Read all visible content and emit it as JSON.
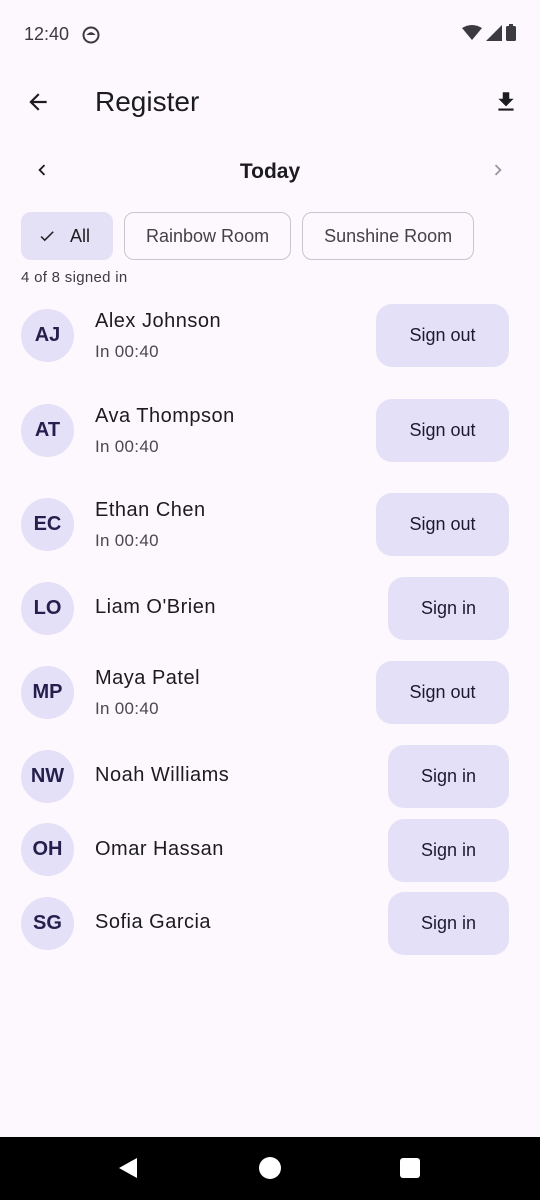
{
  "status_bar": {
    "time": "12:40"
  },
  "header": {
    "title": "Register"
  },
  "date_nav": {
    "label": "Today"
  },
  "filters": {
    "chips": [
      {
        "label": "All",
        "selected": true
      },
      {
        "label": "Rainbow Room",
        "selected": false
      },
      {
        "label": "Sunshine Room",
        "selected": false
      }
    ]
  },
  "summary": {
    "count_text": "4 of 8 signed in"
  },
  "children": [
    {
      "initials": "AJ",
      "name": "Alex Johnson",
      "status": "In 00:40",
      "action": "Sign out"
    },
    {
      "initials": "AT",
      "name": "Ava Thompson",
      "status": "In 00:40",
      "action": "Sign out"
    },
    {
      "initials": "EC",
      "name": "Ethan Chen",
      "status": "In 00:40",
      "action": "Sign out"
    },
    {
      "initials": "LO",
      "name": "Liam O'Brien",
      "status": "",
      "action": "Sign in"
    },
    {
      "initials": "MP",
      "name": "Maya Patel",
      "status": "In 00:40",
      "action": "Sign out"
    },
    {
      "initials": "NW",
      "name": "Noah Williams",
      "status": "",
      "action": "Sign in"
    },
    {
      "initials": "OH",
      "name": "Omar Hassan",
      "status": "",
      "action": "Sign in"
    },
    {
      "initials": "SG",
      "name": "Sofia Garcia",
      "status": "",
      "action": "Sign in"
    }
  ],
  "icons": {
    "back": "arrow-back-icon",
    "download": "download-icon",
    "prev": "chevron-left-icon",
    "next": "chevron-right-icon",
    "check": "check-icon"
  },
  "colors": {
    "background": "#fdf8fd",
    "tonal_button": "#e4e0f8",
    "avatar": "#e4e0f8",
    "chip_selected": "#e4e0f5"
  }
}
